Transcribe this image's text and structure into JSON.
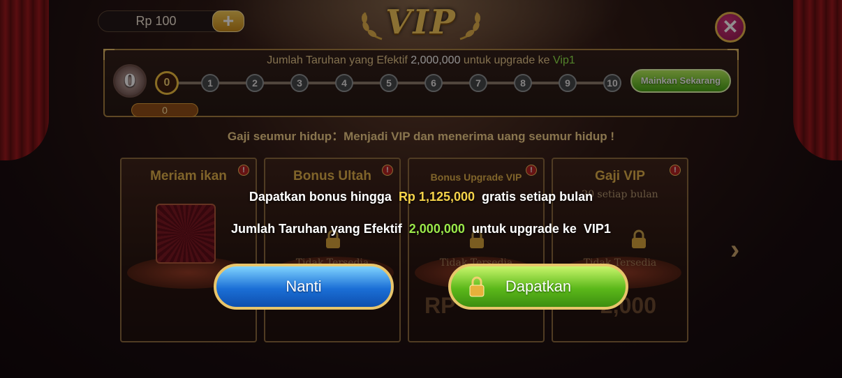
{
  "balance": {
    "text": "Rp 100",
    "add_label": "+"
  },
  "header": {
    "title": "VIP",
    "close_label": "✕"
  },
  "progress": {
    "text_prefix": "Jumlah Taruhan yang Efektif",
    "amount": "2,000,000",
    "text_middle": "untuk upgrade ke",
    "target_level": "Vip1",
    "current_level": "0",
    "levels": [
      "0",
      "1",
      "2",
      "3",
      "4",
      "5",
      "6",
      "7",
      "8",
      "9",
      "10"
    ],
    "value": "0",
    "fill_fraction": 0,
    "play_label": "Mainkan Sekarang"
  },
  "lifetime_text": "Gaji seumur hidup：Menjadi VIP dan menerima uang seumur hidup !",
  "cards": [
    {
      "title": "Meriam ikan"
    },
    {
      "title": "Bonus Ultah",
      "status": "Tidak Tersedia"
    },
    {
      "title": "Bonus Upgrade VIP",
      "status": "Tidak Tersedia",
      "amount": "RP"
    },
    {
      "title": "Gaji VIP",
      "subtitle": "20 setiap bulan",
      "status": "Tidak Tersedia",
      "amount": "2,000"
    }
  ],
  "popup": {
    "line1_prefix": "Dapatkan bonus hingga",
    "line1_amount": "Rp 1,125,000",
    "line1_suffix": "gratis setiap bulan",
    "line2_prefix": "Jumlah Taruhan yang Efektif",
    "line2_amount": "2,000,000",
    "line2_suffix": "untuk upgrade ke",
    "line2_level": "VIP1",
    "later_label": "Nanti",
    "get_label": "Dapatkan"
  },
  "icons": [
    "plus-icon",
    "close-icon",
    "laurel-icon",
    "info-icon",
    "lock-icon",
    "chevron-right-icon"
  ],
  "colors": {
    "gold": "#f5d34a",
    "green": "#9be84a",
    "accent_blue": "#1b6fd6",
    "accent_green": "#5bb81a"
  }
}
